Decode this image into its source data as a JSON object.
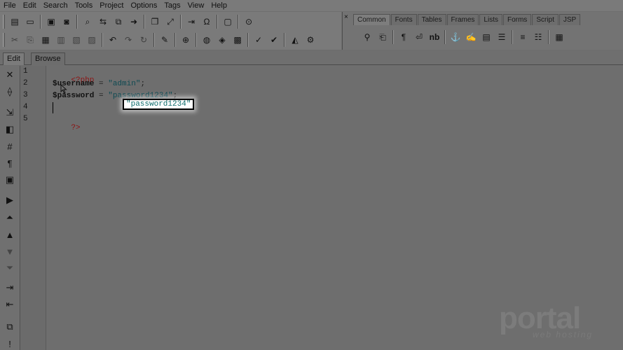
{
  "menu": [
    "File",
    "Edit",
    "Search",
    "Tools",
    "Project",
    "Options",
    "Tags",
    "View",
    "Help"
  ],
  "toolbar_icons": {
    "row1": [
      "new-file-icon",
      "open-file-icon",
      "save-icon",
      "save-all-icon",
      "find-icon",
      "replace-icon",
      "find-in-files-icon",
      "goto-icon",
      "window-icon",
      "fullscreen-icon",
      "indent-icon",
      "special-char-icon",
      "preview-icon",
      "validate-icon"
    ],
    "row2": [
      "cut-icon",
      "copy-icon",
      "paste-icon",
      "paste-special-icon",
      "delete-icon",
      "clear-icon",
      "undo-icon",
      "redo-icon",
      "refresh-icon",
      "brush-icon",
      "zoom-icon",
      "globe-icon",
      "code-view-icon",
      "image-icon",
      "spellcheck-icon",
      "spellcheck-alt-icon",
      "design-icon",
      "settings-icon"
    ]
  },
  "tag_panel": {
    "close_glyph": "×",
    "tabs": [
      "Common",
      "Fonts",
      "Tables",
      "Frames",
      "Lists",
      "Forms",
      "Script",
      "JSP"
    ],
    "active_tab": "Common",
    "pilcrow": "¶",
    "nbsp_label": "nb"
  },
  "editor_tabs": [
    "Edit",
    "Browse"
  ],
  "line_numbers": [
    "1",
    "2",
    "3",
    "4",
    "5"
  ],
  "code": {
    "l1": "<?php",
    "l2_var": "$username",
    "l2_op": " = ",
    "l2_str": "\"admin\"",
    "l2_end": ";",
    "l3_var": "$password",
    "l3_op": " = ",
    "l3_str": "\"password1234\"",
    "l3_end": ";",
    "l5": "?>"
  },
  "tooltip_text": "\"password1234\"",
  "watermark": {
    "brand": "portal",
    "sub": "web hosting"
  },
  "colors": {
    "php_tag": "#8d1414",
    "string": "#0e4a52",
    "tooltip_text": "#0d6b6b"
  }
}
